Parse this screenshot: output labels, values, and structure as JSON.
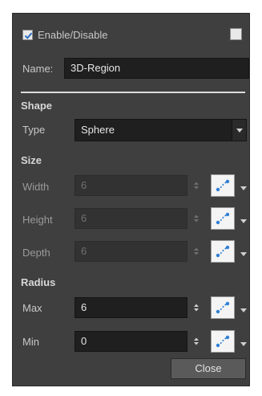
{
  "header": {
    "enable_label": "Enable/Disable",
    "enable_checked": true,
    "right_checkbox_checked": false
  },
  "name": {
    "label": "Name:",
    "value": "3D-Region"
  },
  "shape": {
    "title": "Shape",
    "type_label": "Type",
    "type_value": "Sphere"
  },
  "size": {
    "title": "Size",
    "width": {
      "label": "Width",
      "value": "6"
    },
    "height": {
      "label": "Height",
      "value": "6"
    },
    "depth": {
      "label": "Depth",
      "value": "6"
    }
  },
  "radius": {
    "title": "Radius",
    "max": {
      "label": "Max",
      "value": "6"
    },
    "min": {
      "label": "Min",
      "value": "0"
    }
  },
  "footer": {
    "close_label": "Close"
  },
  "icons": {
    "function_button": "function-curve-icon",
    "dropdown": "triangle-down-icon",
    "spinner": "spin-updown-icon"
  },
  "colors": {
    "panel_bg": "#3f3f3f",
    "field_bg": "#1f1f1f",
    "accent_blue": "#2f7fd4"
  }
}
